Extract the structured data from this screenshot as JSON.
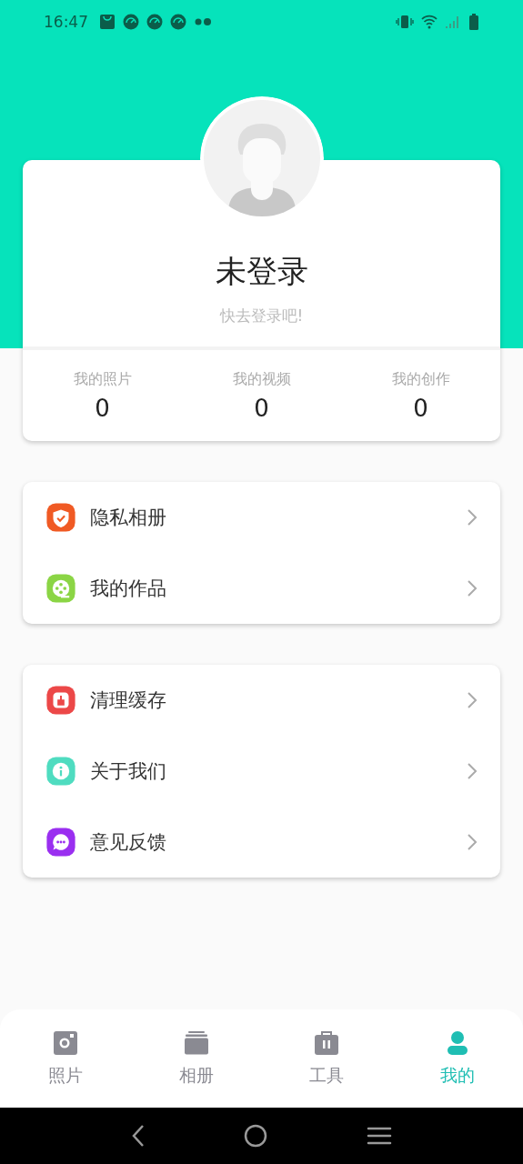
{
  "status_bar": {
    "time": "16:47"
  },
  "profile": {
    "name": "未登录",
    "hint": "快去登录吧!",
    "stats": [
      {
        "label": "我的照片",
        "value": "0"
      },
      {
        "label": "我的视频",
        "value": "0"
      },
      {
        "label": "我的创作",
        "value": "0"
      }
    ]
  },
  "menu_groups": [
    {
      "items": [
        {
          "label": "隐私相册",
          "color": "#f05a24"
        },
        {
          "label": "我的作品",
          "color": "#8bd545"
        }
      ]
    },
    {
      "items": [
        {
          "label": "清理缓存",
          "color": "#ec4848"
        },
        {
          "label": "关于我们",
          "color": "#4fdcc0"
        },
        {
          "label": "意见反馈",
          "color": "#9a2ff0"
        }
      ]
    }
  ],
  "tabs": [
    {
      "label": "照片",
      "selected": false
    },
    {
      "label": "相册",
      "selected": false
    },
    {
      "label": "工具",
      "selected": false
    },
    {
      "label": "我的",
      "selected": true
    }
  ]
}
